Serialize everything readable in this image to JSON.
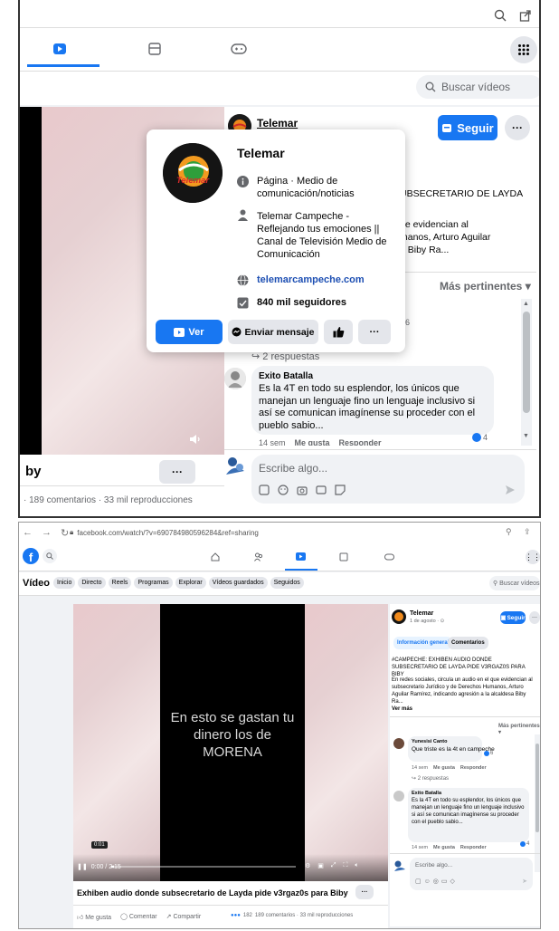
{
  "top": {
    "search_placeholder": "Buscar vídeos",
    "page_name": "Telemar",
    "follow_label": "Seguir",
    "post_title_partial": "UBSECRETARIO DE LAYDA",
    "post_body_partial": [
      "ue evidencian al",
      "manos, Arturo Aguilar",
      "a Biby Ra..."
    ],
    "sort_label": "Más pertinentes",
    "reaction_count": "6",
    "replies_label": "2 respuestas",
    "comment2_author": "Exito Batalla",
    "comment2_text": "Es la 4T en todo su esplendor, los únicos que manejan un lenguaje fino un lenguaje inclusivo si así se comunican imagínense su proceder con el pueblo sabio...",
    "comment2_reactions": "4",
    "comment2_meta": [
      "14 sem",
      "Me gusta",
      "Responder"
    ],
    "write_placeholder": "Escribe algo...",
    "title_partial": "by",
    "stats_partial": "· 189 comentarios · 33 mil reproducciones",
    "more_label": "···",
    "hovercard": {
      "name": "Telemar",
      "category": "Página · Medio de comunicación/noticias",
      "bio": "Telemar Campeche - Reflejando tus emociones || Canal de Televisión Medio de Comunicación",
      "website": "telemarcampeche.com",
      "followers": "840 mil seguidores",
      "ver_label": "Ver",
      "message_label": "Enviar mensaje",
      "logo_text": "Telemar"
    }
  },
  "bottom": {
    "url": "facebook.com/watch/?v=690784980596284&ref=sharing",
    "nav_title": "Vídeo",
    "nav_tabs": [
      "Inicio",
      "Directo",
      "Reels",
      "Programas",
      "Explorar",
      "Vídeos guardados",
      "Seguidos"
    ],
    "search_placeholder": "Buscar vídeos",
    "video_caption": "En esto se gastan tu dinero los de MORENA",
    "badge": "0:01",
    "time": "0:00 / 2:15",
    "video_title": "Exhiben audio donde subsecretario de Layda pide v3rgaz0s para Biby",
    "actions": [
      "Me gusta",
      "Comentar",
      "Compartir"
    ],
    "reactions_count": "182",
    "stats": "189 comentarios · 33 mil reproducciones",
    "page_name": "Telemar",
    "date": "1 de agosto · ⊙",
    "follow_label": "Seguir",
    "tab_info": "Información general",
    "tab_comments": "Comentarios",
    "post_title": "#CAMPECHE: EXHIBEN AUDIO DONDE SUBSECRETARIO DE LAYDA PIDE V3RGAZ0S PARA BIBY",
    "post_body": "En redes sociales, circula un audio en el que evidencian al subsecretario Jurídico y de Derechos Humanos, Arturo Aguilar Ramírez, indicando agresión a la alcaldesa Biby Ra...",
    "see_more": "Ver más",
    "sort_label": "Más pertinentes",
    "comment1_author": "Yunesisi Canto",
    "comment1_text": "Que triste es la 4t en campeche",
    "comment1_reactions": "6",
    "comment1_meta": [
      "14 sem",
      "Me gusta",
      "Responder"
    ],
    "replies_label": "2 respuestas",
    "comment2_author": "Exito Batalla",
    "comment2_text": "Es la 4T en todo su esplendor, los únicos que manejan un lenguaje fino un lenguaje inclusivo si así se comunican imagínense su proceder con el pueblo sabio...",
    "comment2_meta": [
      "14 sem",
      "Me gusta",
      "Responder"
    ],
    "comment2_reactions": "4",
    "write_placeholder": "Escribe algo..."
  },
  "colors": {
    "accent": "#1877f2",
    "bg": "#f0f2f5",
    "video_black": "#000000"
  }
}
